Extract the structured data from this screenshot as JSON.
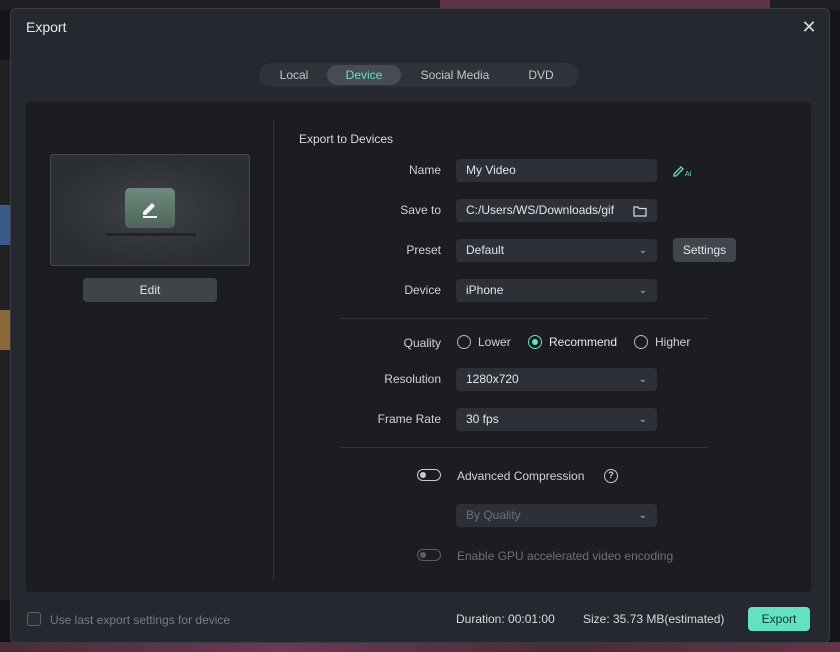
{
  "dialog": {
    "title": "Export"
  },
  "tabs": [
    {
      "label": "Local"
    },
    {
      "label": "Device"
    },
    {
      "label": "Social Media"
    },
    {
      "label": "DVD"
    }
  ],
  "active_tab": "Device",
  "preview": {
    "edit_label": "Edit"
  },
  "form": {
    "section_title": "Export to Devices",
    "name": {
      "label": "Name",
      "value": "My Video"
    },
    "save_to": {
      "label": "Save to",
      "value": "C:/Users/WS/Downloads/gif"
    },
    "preset": {
      "label": "Preset",
      "value": "Default",
      "settings_label": "Settings"
    },
    "device": {
      "label": "Device",
      "value": "iPhone"
    },
    "quality": {
      "label": "Quality",
      "options": [
        "Lower",
        "Recommend",
        "Higher"
      ],
      "selected": "Recommend"
    },
    "resolution": {
      "label": "Resolution",
      "value": "1280x720"
    },
    "frame_rate": {
      "label": "Frame Rate",
      "value": "30 fps"
    },
    "advanced_compression": {
      "label": "Advanced Compression",
      "enabled": false,
      "mode": "By Quality"
    },
    "gpu": {
      "label": "Enable GPU accelerated video encoding",
      "enabled": false
    }
  },
  "footer": {
    "use_last_label": "Use last export settings for device",
    "duration": "Duration: 00:01:00",
    "size": "Size: 35.73 MB(estimated)",
    "export_label": "Export"
  },
  "colors": {
    "accent": "#5fe3c3",
    "background": "#25282e",
    "panel": "#1b1d21"
  }
}
